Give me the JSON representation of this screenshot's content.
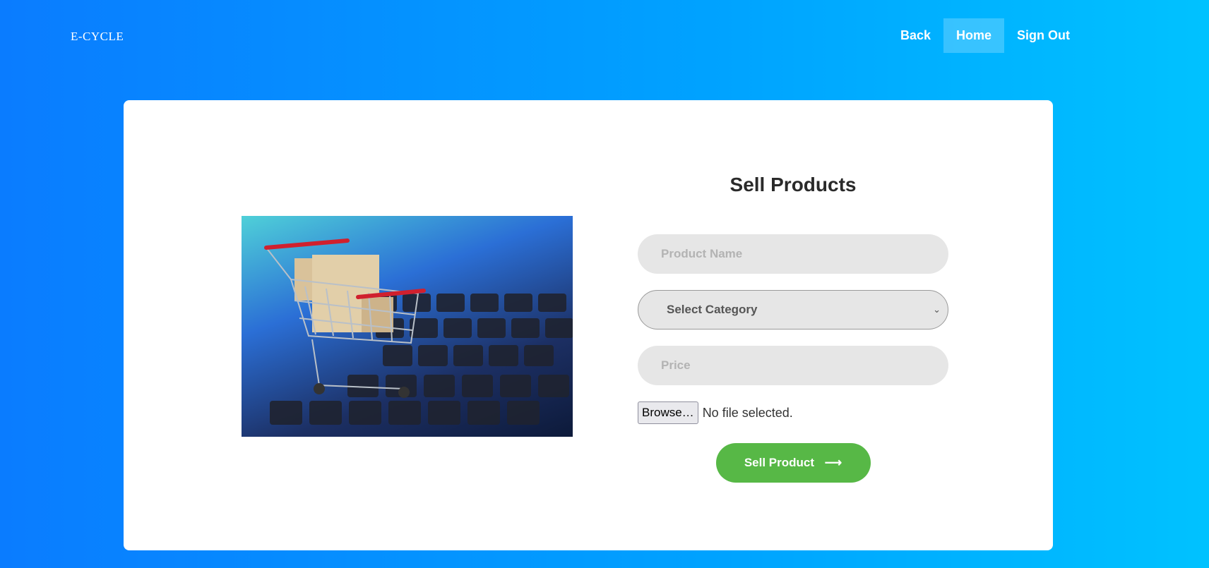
{
  "brand": "E-CYCLE",
  "nav": {
    "back": "Back",
    "home": "Home",
    "sign_out": "Sign Out"
  },
  "form": {
    "title": "Sell Products",
    "product_name_placeholder": "Product Name",
    "category_selected": "Select Category",
    "price_placeholder": "Price",
    "browse_label": "Browse…",
    "file_status": "No file selected.",
    "submit_label": "Sell Product"
  },
  "icons": {
    "submit_arrow": "arrow-right-icon",
    "select_chevron": "chevron-down-icon",
    "photo": "shopping-cart-icon"
  }
}
